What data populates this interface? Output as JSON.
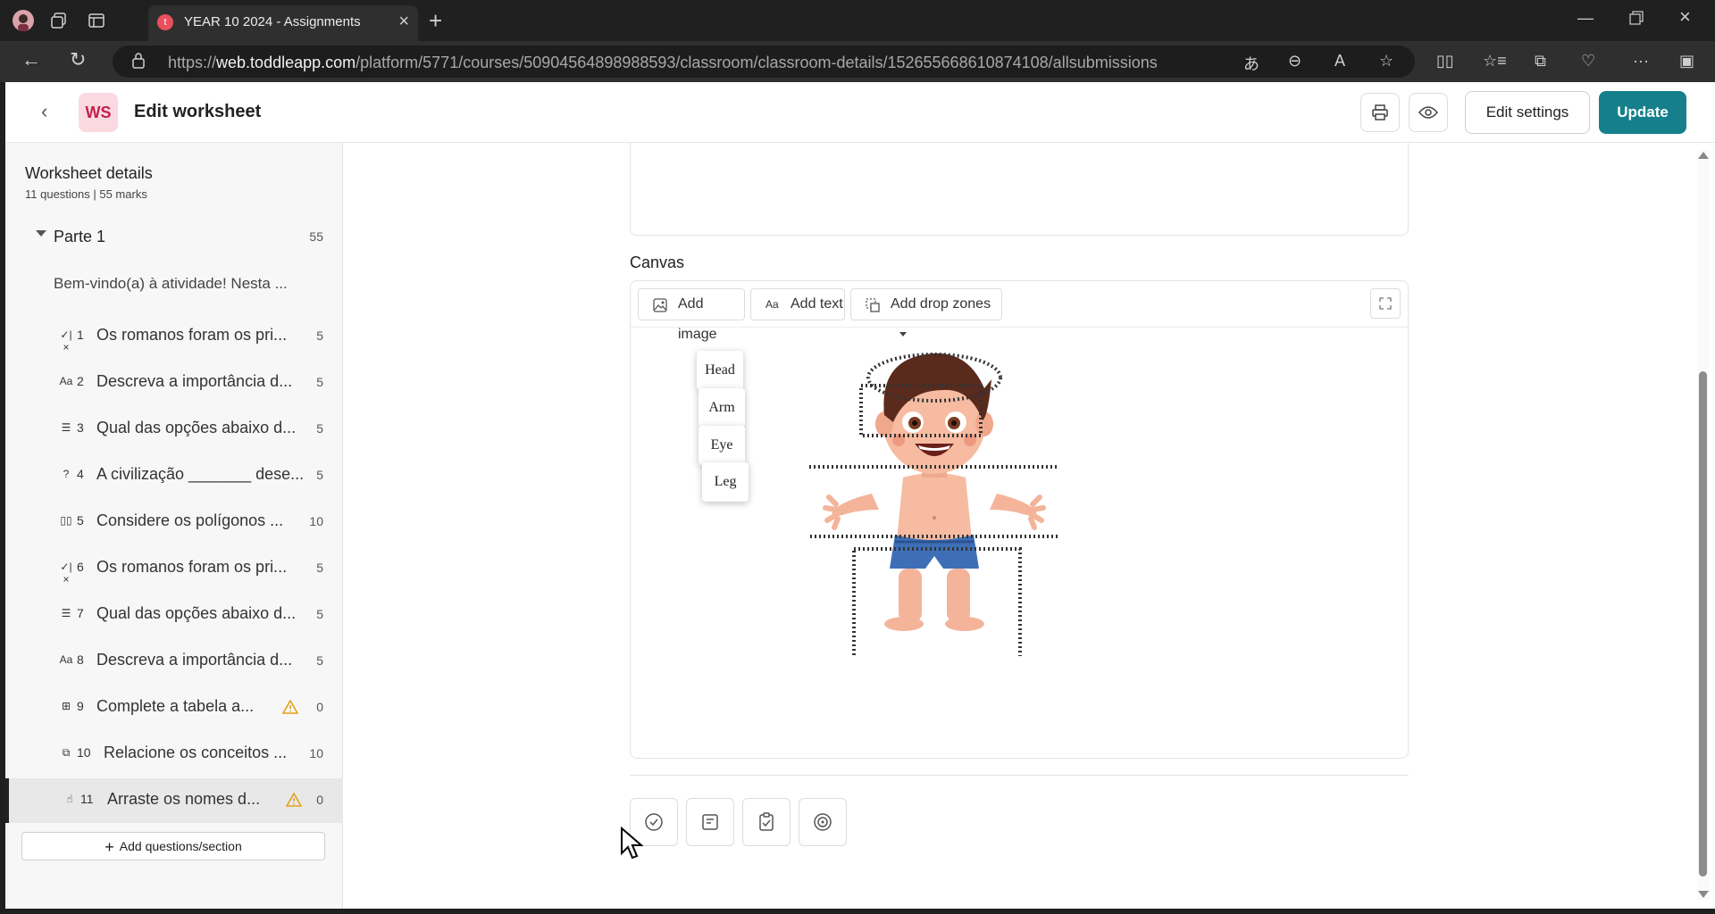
{
  "browser": {
    "tab_title": "YEAR 10 2024 - Assignments",
    "favicon_letter": "t",
    "url_prefix": "https://",
    "url_domain": "web.toddleapp.com",
    "url_path": "/platform/5771/courses/50904564898988593/classroom/classroom-details/152655668610874108/allsubmissions"
  },
  "header": {
    "badge": "WS",
    "title": "Edit worksheet",
    "edit_settings_label": "Edit settings",
    "update_label": "Update"
  },
  "sidebar": {
    "title": "Worksheet details",
    "subtitle": "11 questions | 55 marks",
    "section": {
      "name": "Parte 1",
      "marks": "55"
    },
    "intro": "Bem-vindo(a) à atividade! Nesta ...",
    "questions": [
      {
        "num": "1",
        "icon": "true-false-icon",
        "glyph": "✓|×",
        "text": "Os romanos foram os pri...",
        "marks": "5"
      },
      {
        "num": "2",
        "icon": "text-answer-icon",
        "glyph": "Aa",
        "text": "Descreva a importância d...",
        "marks": "5"
      },
      {
        "num": "3",
        "icon": "multiple-choice-icon",
        "glyph": "☰",
        "text": "Qual das opções abaixo d...",
        "marks": "5"
      },
      {
        "num": "4",
        "icon": "fill-blank-icon",
        "glyph": "?",
        "text": "A civilização _______ dese...",
        "marks": "5"
      },
      {
        "num": "5",
        "icon": "polygon-icon",
        "glyph": "▯▯",
        "text": "Considere os polígonos ...",
        "marks": "10"
      },
      {
        "num": "6",
        "icon": "true-false-icon",
        "glyph": "✓|×",
        "text": "Os romanos foram os pri...",
        "marks": "5"
      },
      {
        "num": "7",
        "icon": "multiple-choice-icon",
        "glyph": "☰",
        "text": "Qual das opções abaixo d...",
        "marks": "5"
      },
      {
        "num": "8",
        "icon": "text-answer-icon",
        "glyph": "Aa",
        "text": "Descreva a importância d...",
        "marks": "5"
      },
      {
        "num": "9",
        "icon": "table-icon",
        "glyph": "⊞",
        "text": "Complete a tabela a...",
        "marks": "0",
        "warning": true
      },
      {
        "num": "10",
        "icon": "match-icon",
        "glyph": "⧉",
        "text": "Relacione os conceitos ...",
        "marks": "10"
      },
      {
        "num": "11",
        "icon": "drag-hand-icon",
        "glyph": "☝",
        "text": "Arraste os nomes d...",
        "marks": "0",
        "warning": true,
        "active": true
      }
    ],
    "add_label": "Add questions/section"
  },
  "canvas": {
    "label": "Canvas",
    "toolbar": {
      "add_image": "Add image",
      "add_text": "Add text",
      "add_drop_zones": "Add drop zones"
    },
    "chips": [
      "Head",
      "Arm",
      "Eye",
      "Leg"
    ]
  },
  "colors": {
    "accent": "#157f8c",
    "badge_bg": "#fbd9e0",
    "badge_text": "#c3214a",
    "warning": "#e0a21a"
  }
}
